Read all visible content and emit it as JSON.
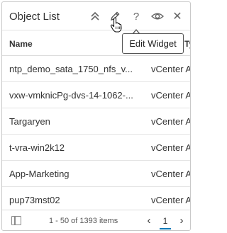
{
  "widget": {
    "title": "Object List",
    "icons": {
      "collapse": "double-chevron-up-icon",
      "edit": "pencil-icon",
      "help": "question-mark-icon",
      "view": "eye-icon",
      "close": "close-icon"
    },
    "help_glyph": "?",
    "close_glyph": "✕"
  },
  "tooltip": {
    "text": "Edit Widget"
  },
  "table": {
    "columns": [
      "Name",
      "Ty"
    ],
    "rows": [
      {
        "name": "ntp_demo_sata_1750_nfs_v...",
        "type": "vCenter A"
      },
      {
        "name": "vxw-vmknicPg-dvs-14-1062-...",
        "type": "vCenter A"
      },
      {
        "name": "Targaryen",
        "type": "vCenter A"
      },
      {
        "name": "t-vra-win2k12",
        "type": "vCenter A"
      },
      {
        "name": "App-Marketing",
        "type": "vCenter A"
      },
      {
        "name": "pup73mst02",
        "type": "vCenter A"
      }
    ]
  },
  "footer": {
    "items_text": "1 - 50 of 1393 items",
    "prev": "‹",
    "page": "1",
    "next": "›"
  },
  "colors": {
    "accent": "#0079b8"
  }
}
